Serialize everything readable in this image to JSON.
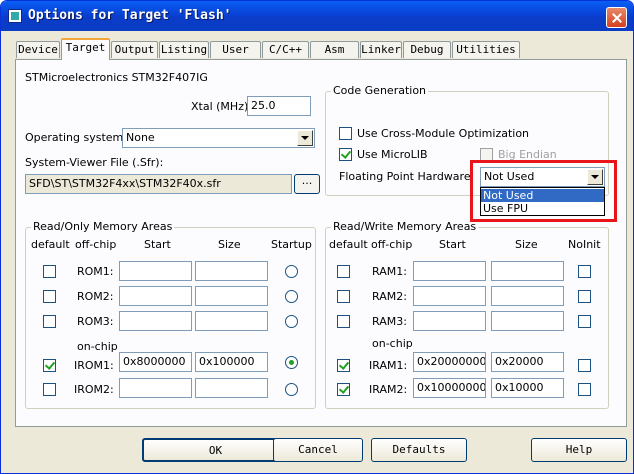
{
  "window": {
    "title": "Options for Target 'Flash'"
  },
  "tabs": [
    {
      "label": "Device"
    },
    {
      "label": "Target"
    },
    {
      "label": "Output"
    },
    {
      "label": "Listing"
    },
    {
      "label": "User"
    },
    {
      "label": "C/C++"
    },
    {
      "label": "Asm"
    },
    {
      "label": "Linker"
    },
    {
      "label": "Debug"
    },
    {
      "label": "Utilities"
    }
  ],
  "active_tab": "Target",
  "target": {
    "device_name": "STMicroelectronics STM32F407IG",
    "xtal_label": "Xtal (MHz):",
    "xtal_value": "25.0",
    "os_label": "Operating system:",
    "os_value": "None",
    "sfr_label": "System-Viewer File (.Sfr):",
    "sfr_value": "SFD\\ST\\STM32F4xx\\STM32F40x.sfr",
    "browse_label": "..."
  },
  "code_generation": {
    "title": "Code Generation",
    "cross_module_label": "Use Cross-Module Optimization",
    "cross_module_checked": false,
    "microlib_label": "Use MicroLIB",
    "microlib_checked": true,
    "big_endian_label": "Big Endian",
    "big_endian_checked": false,
    "fpu_label": "Floating Point Hardware:",
    "fpu_value": "Not Used",
    "fpu_options": [
      "Not Used",
      "Use FPU"
    ],
    "fpu_selected_option": "Not Used"
  },
  "ro_memory": {
    "title": "Read/Only Memory Areas",
    "headers": {
      "default": "default",
      "offchip": "off-chip",
      "start": "Start",
      "size": "Size",
      "startup": "Startup"
    },
    "onchip_label": "on-chip",
    "rows": [
      {
        "name": "ROM1:",
        "default": false,
        "start": "",
        "size": "",
        "startup": false
      },
      {
        "name": "ROM2:",
        "default": false,
        "start": "",
        "size": "",
        "startup": false
      },
      {
        "name": "ROM3:",
        "default": false,
        "start": "",
        "size": "",
        "startup": false
      },
      {
        "name": "IROM1:",
        "default": true,
        "start": "0x8000000",
        "size": "0x100000",
        "startup": true
      },
      {
        "name": "IROM2:",
        "default": false,
        "start": "",
        "size": "",
        "startup": false
      }
    ]
  },
  "rw_memory": {
    "title": "Read/Write Memory Areas",
    "headers": {
      "default": "default",
      "offchip": "off-chip",
      "start": "Start",
      "size": "Size",
      "noinit": "NoInit"
    },
    "onchip_label": "on-chip",
    "rows": [
      {
        "name": "RAM1:",
        "default": false,
        "start": "",
        "size": "",
        "noinit": false
      },
      {
        "name": "RAM2:",
        "default": false,
        "start": "",
        "size": "",
        "noinit": false
      },
      {
        "name": "RAM3:",
        "default": false,
        "start": "",
        "size": "",
        "noinit": false
      },
      {
        "name": "IRAM1:",
        "default": true,
        "start": "0x20000000",
        "size": "0x20000",
        "noinit": false
      },
      {
        "name": "IRAM2:",
        "default": true,
        "start": "0x10000000",
        "size": "0x10000",
        "noinit": false
      }
    ]
  },
  "buttons": {
    "ok": "OK",
    "cancel": "Cancel",
    "defaults": "Defaults",
    "help": "Help"
  },
  "colors": {
    "title_bar": "#0842d6",
    "highlight_box": "#e8161b",
    "selection": "#316ac5",
    "dialog_face": "#ece9d8"
  }
}
